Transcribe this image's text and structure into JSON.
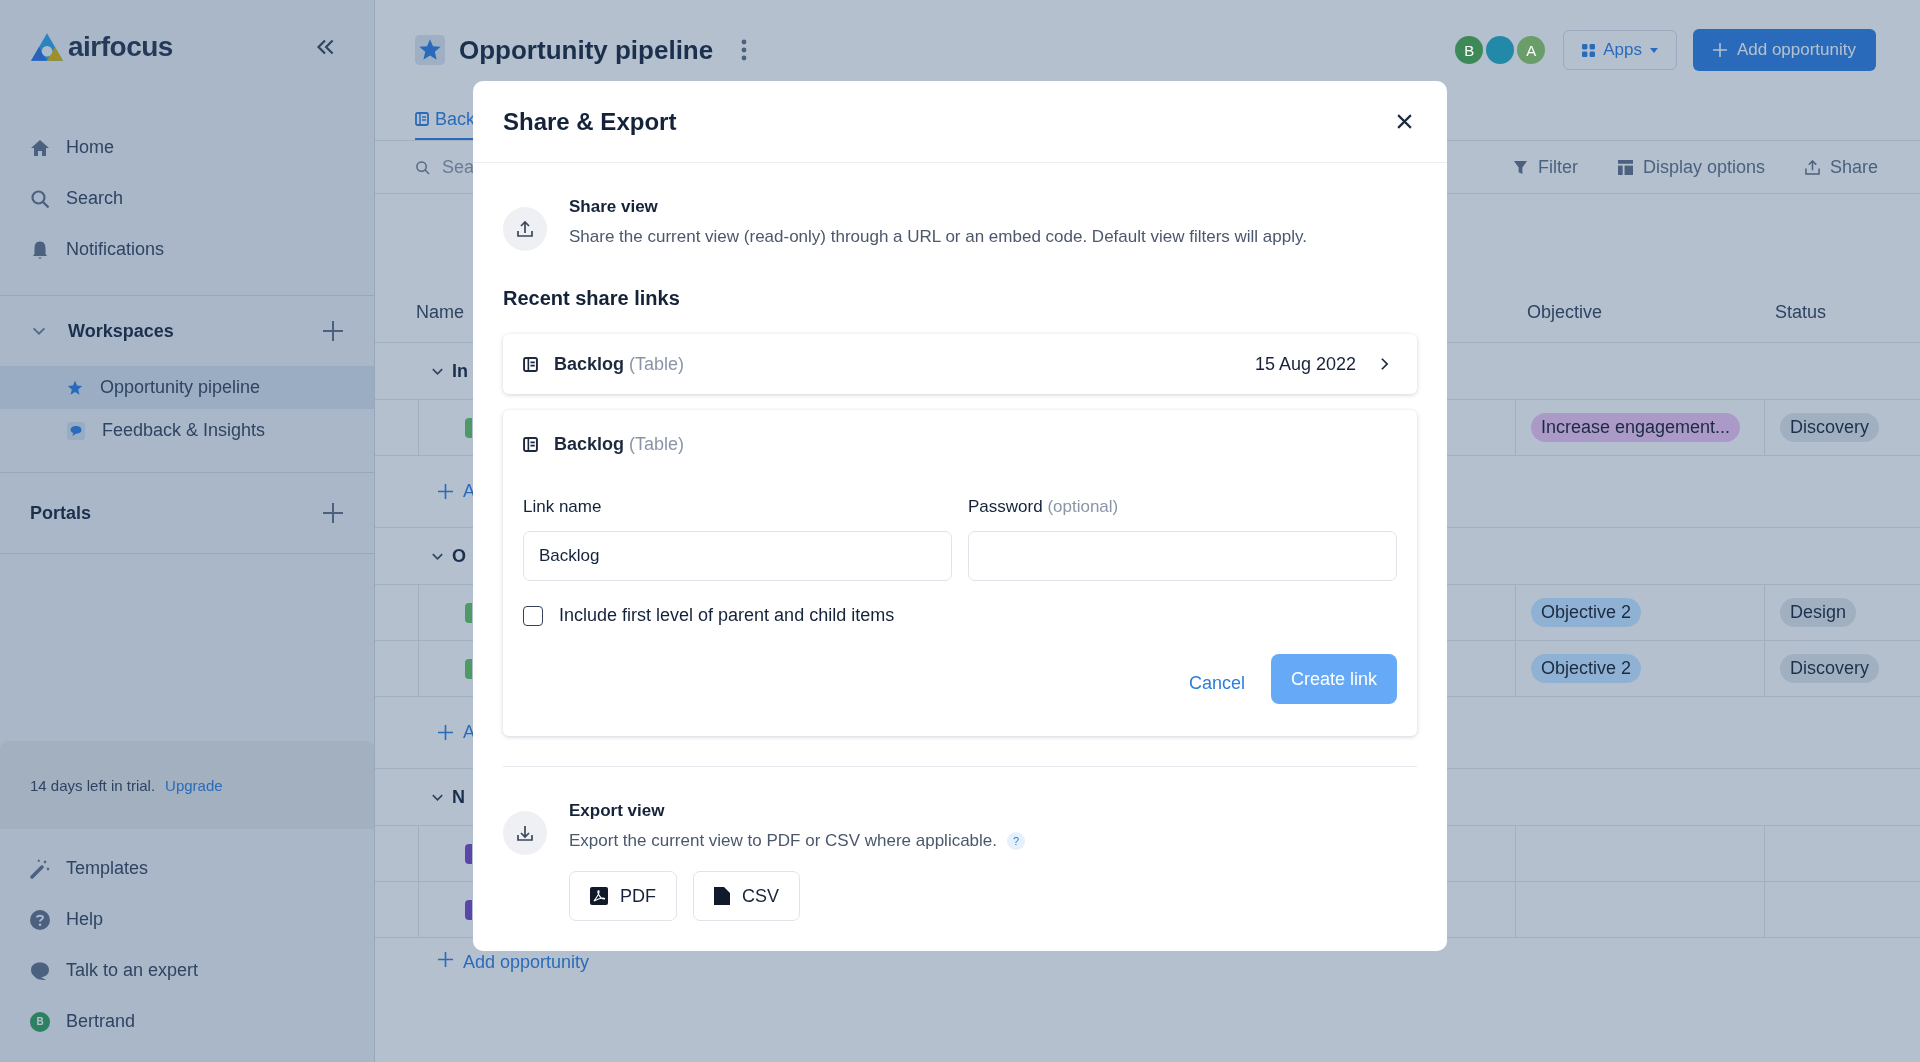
{
  "sidebar": {
    "logo": "airfocus",
    "nav": [
      {
        "label": "Home"
      },
      {
        "label": "Search"
      },
      {
        "label": "Notifications"
      }
    ],
    "workspaces": {
      "title": "Workspaces",
      "expanded": true,
      "items": [
        {
          "label": "Opportunity pipeline",
          "selected": true
        },
        {
          "label": "Feedback & Insights",
          "selected": false
        }
      ]
    },
    "portals": {
      "title": "Portals"
    },
    "trial": {
      "text": "14 days left in trial.",
      "link": "Upgrade"
    },
    "bottom": [
      {
        "label": "Templates"
      },
      {
        "label": "Help"
      },
      {
        "label": "Talk to an expert"
      },
      {
        "label": "Bertrand",
        "initial": "B"
      }
    ]
  },
  "header": {
    "title": "Opportunity pipeline",
    "avatars": [
      {
        "initial": "B",
        "color": "#3d8a58"
      },
      {
        "color": "#2389a8"
      },
      {
        "initial": "A",
        "color": "#6a9e68"
      }
    ],
    "apps_button": "Apps",
    "add_button": "Add opportunity"
  },
  "tabs": [
    {
      "label": "Back",
      "selected": true
    }
  ],
  "toolbar": {
    "search_placeholder": "Sea",
    "actions": [
      {
        "label": "Filter"
      },
      {
        "label": "Display options"
      },
      {
        "label": "Share"
      }
    ]
  },
  "table": {
    "columns": [
      "Name",
      "Objective",
      "Status"
    ],
    "groups": [
      {
        "label": "In",
        "expanded": true,
        "add_label": "A",
        "rows": [
          {
            "color": "#4c9a66",
            "objective": {
              "text": "Increase engagement...",
              "color": "#ab9ac8"
            },
            "status": "Discovery"
          }
        ]
      },
      {
        "label": "O",
        "expanded": true,
        "add_label": "A",
        "rows": [
          {
            "color": "#4c9a66",
            "objective": {
              "text": "Objective 2",
              "color": "#8fb2d4"
            },
            "status": "Design"
          },
          {
            "color": "#4c9a66",
            "objective": {
              "text": "Objective 2",
              "color": "#8fb2d4"
            },
            "status": "Discovery"
          }
        ]
      },
      {
        "label": "N",
        "expanded": true,
        "add_label": "Add opportunity",
        "rows": [
          {
            "color": "#5a45a8"
          },
          {
            "color": "#5a45a8"
          }
        ]
      }
    ]
  },
  "modal": {
    "title": "Share & Export",
    "share": {
      "title": "Share view",
      "description": "Share the current view (read-only) through a URL or an embed code. Default view filters will apply."
    },
    "recent_title": "Recent share links",
    "recent_links": [
      {
        "name": "Backlog",
        "type": "(Table)",
        "date": "15 Aug 2022"
      }
    ],
    "new_link": {
      "name": "Backlog",
      "type": "(Table)",
      "link_label": "Link name",
      "link_value": "Backlog",
      "password_label": "Password",
      "password_hint": "(optional)",
      "include_label": "Include first level of parent and child items",
      "include_checked": false,
      "cancel": "Cancel",
      "create": "Create link",
      "create_disabled": true
    },
    "export": {
      "title": "Export view",
      "description": "Export the current view to PDF or CSV where applicable.",
      "help": "?",
      "buttons": [
        {
          "label": "PDF",
          "kind": "pdf"
        },
        {
          "label": "CSV",
          "kind": "csv"
        }
      ]
    }
  }
}
